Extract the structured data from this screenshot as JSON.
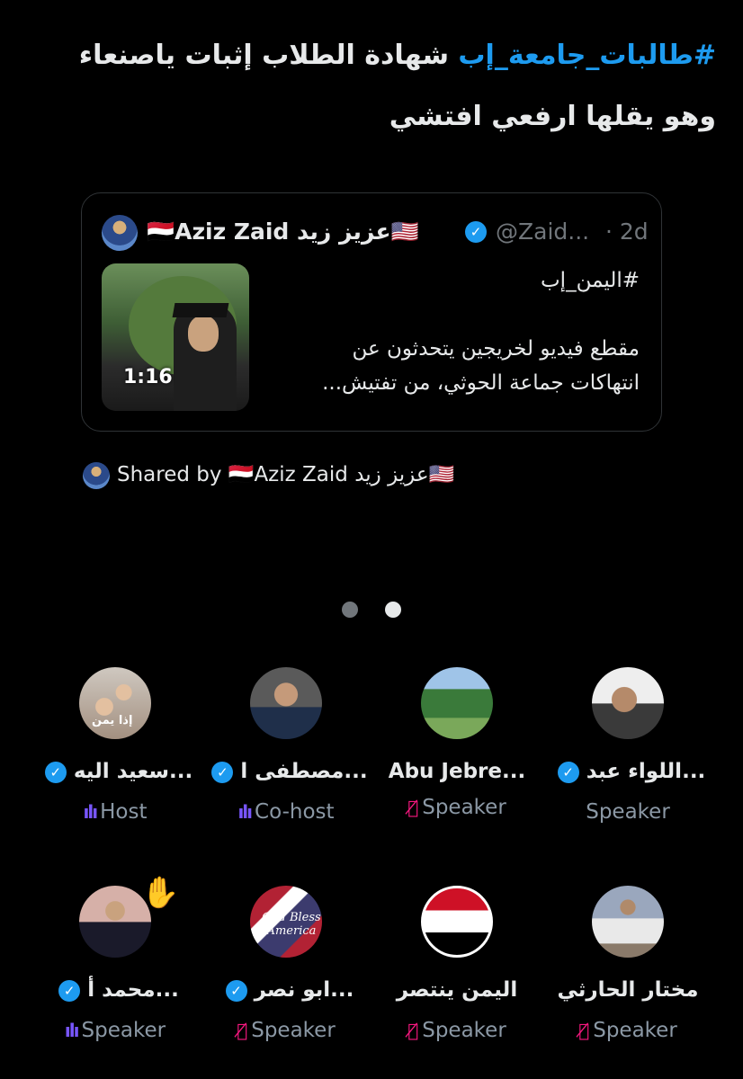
{
  "tweet": {
    "hashtag": "#طالبات_جامعة_إب",
    "text_line1": " شهادة الطلاب إثبات ياصنعاء",
    "text_line2": "وهو يقلها ارفعي افتشي"
  },
  "quote": {
    "author_name": "🇾🇪Aziz Zaid عزيز زيد🇺🇸",
    "handle": "@Zaid...",
    "time": "· 2d",
    "video_duration": "1:16",
    "hashtag": "#اليمن_إب",
    "body_line1": "مقطع فيديو لخريجين يتحدثون عن",
    "body_line2": "انتهاكات جماعة الحوثي، من تفتيش..."
  },
  "shared_by": "Shared by 🇾🇪Aziz Zaid عزيز زيد🇺🇸",
  "pagination": {
    "count": 2,
    "active": 2
  },
  "speakers": [
    {
      "name": "سعيد اليه...",
      "role": "Host",
      "verified": true,
      "status": "talking",
      "avatar_icon": "children-photo",
      "avatar_text": "إذا يمن"
    },
    {
      "name": "مصطفى ا...",
      "role": "Co-host",
      "verified": true,
      "status": "talking",
      "avatar_icon": "man-at-microphone"
    },
    {
      "name": "Abu Jebre...",
      "role": "Speaker",
      "verified": false,
      "status": "muted",
      "avatar_icon": "landscape"
    },
    {
      "name": "اللواء عبد...",
      "role": "Speaker",
      "verified": true,
      "status": "none",
      "avatar_icon": "man-portrait"
    },
    {
      "name": "محمد أ...",
      "role": "Speaker",
      "verified": true,
      "status": "talking",
      "avatar_icon": "man-in-suit",
      "hand_raised": "✋"
    },
    {
      "name": "ابو نصر...",
      "role": "Speaker",
      "verified": true,
      "status": "muted",
      "avatar_icon": "god-bless-america",
      "avatar_text": "God Bless America"
    },
    {
      "name": "اليمن ينتصر",
      "role": "Speaker",
      "verified": false,
      "status": "muted",
      "avatar_icon": "yemen-flag"
    },
    {
      "name": "مختار الحارثي",
      "role": "Speaker",
      "verified": false,
      "status": "muted",
      "avatar_icon": "man-in-white"
    }
  ],
  "icons": {
    "verified": "✓",
    "muted": "🎙̸",
    "talking": "ılı",
    "hand": "✋"
  },
  "colors": {
    "accent": "#1d9bf0",
    "muted": "#f91880",
    "talking": "#7856ff",
    "secondary": "#71767b"
  }
}
